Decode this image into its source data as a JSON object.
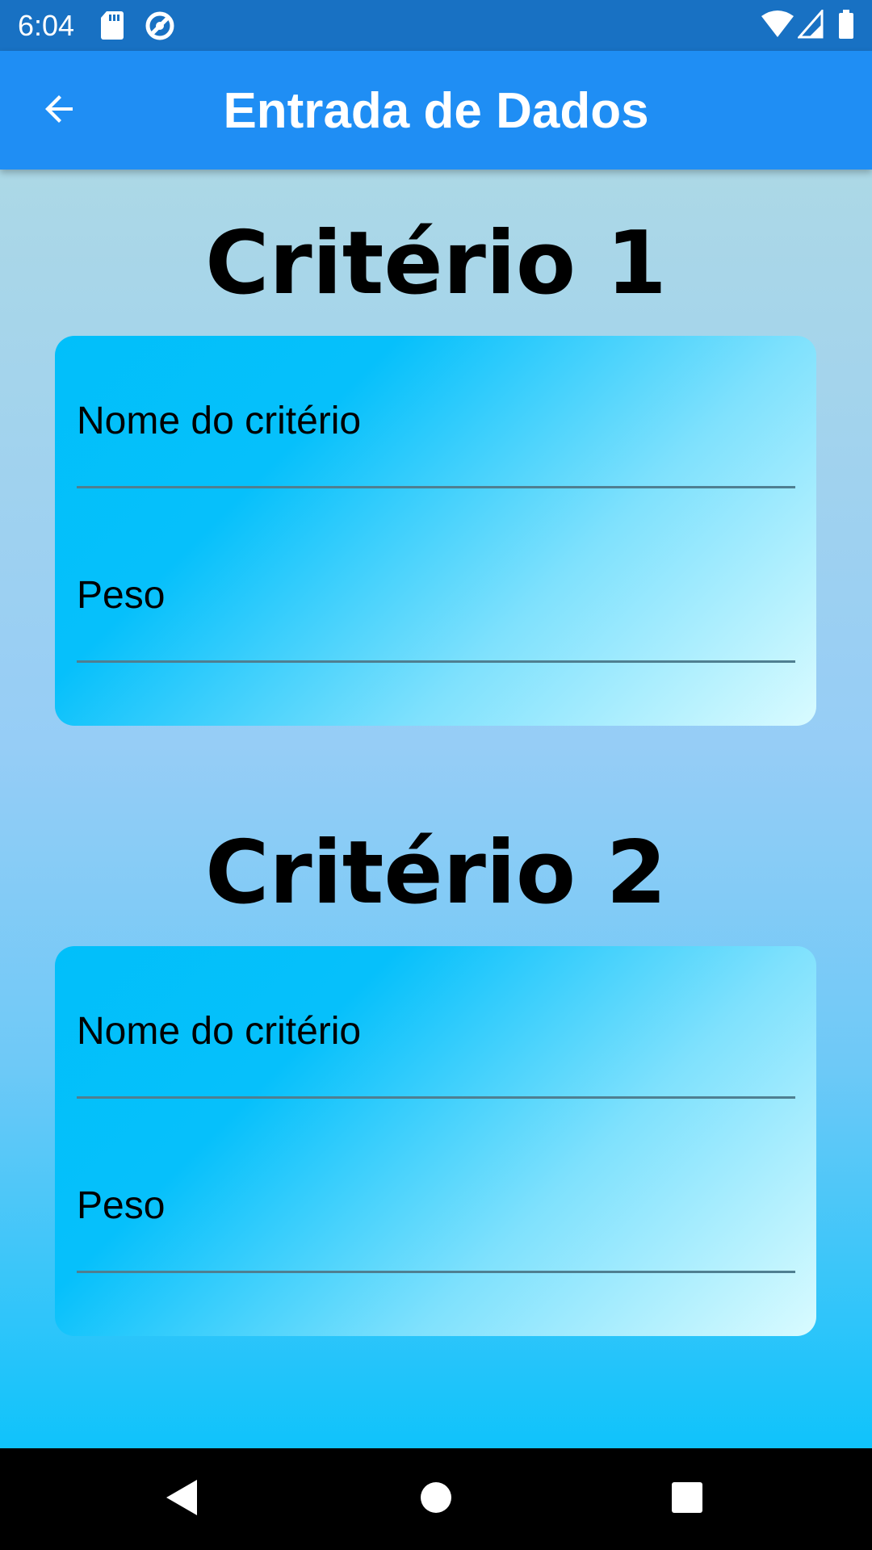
{
  "status_bar": {
    "time": "6:04",
    "icons": [
      "sd-card-icon",
      "data-saver-icon",
      "wifi-icon",
      "cell-signal-icon",
      "battery-icon"
    ]
  },
  "app_bar": {
    "title": "Entrada de Dados",
    "back_icon": "arrow-back-icon",
    "color": "#1f8ef4"
  },
  "sections": [
    {
      "title": "Critério 1",
      "fields": [
        {
          "label": "Nome do critério"
        },
        {
          "label": "Peso"
        }
      ]
    },
    {
      "title": "Critério 2",
      "fields": [
        {
          "label": "Nome do critério"
        },
        {
          "label": "Peso"
        }
      ]
    }
  ],
  "nav_bar": {
    "buttons": [
      "back-triangle-icon",
      "home-circle-icon",
      "recents-square-icon"
    ]
  }
}
